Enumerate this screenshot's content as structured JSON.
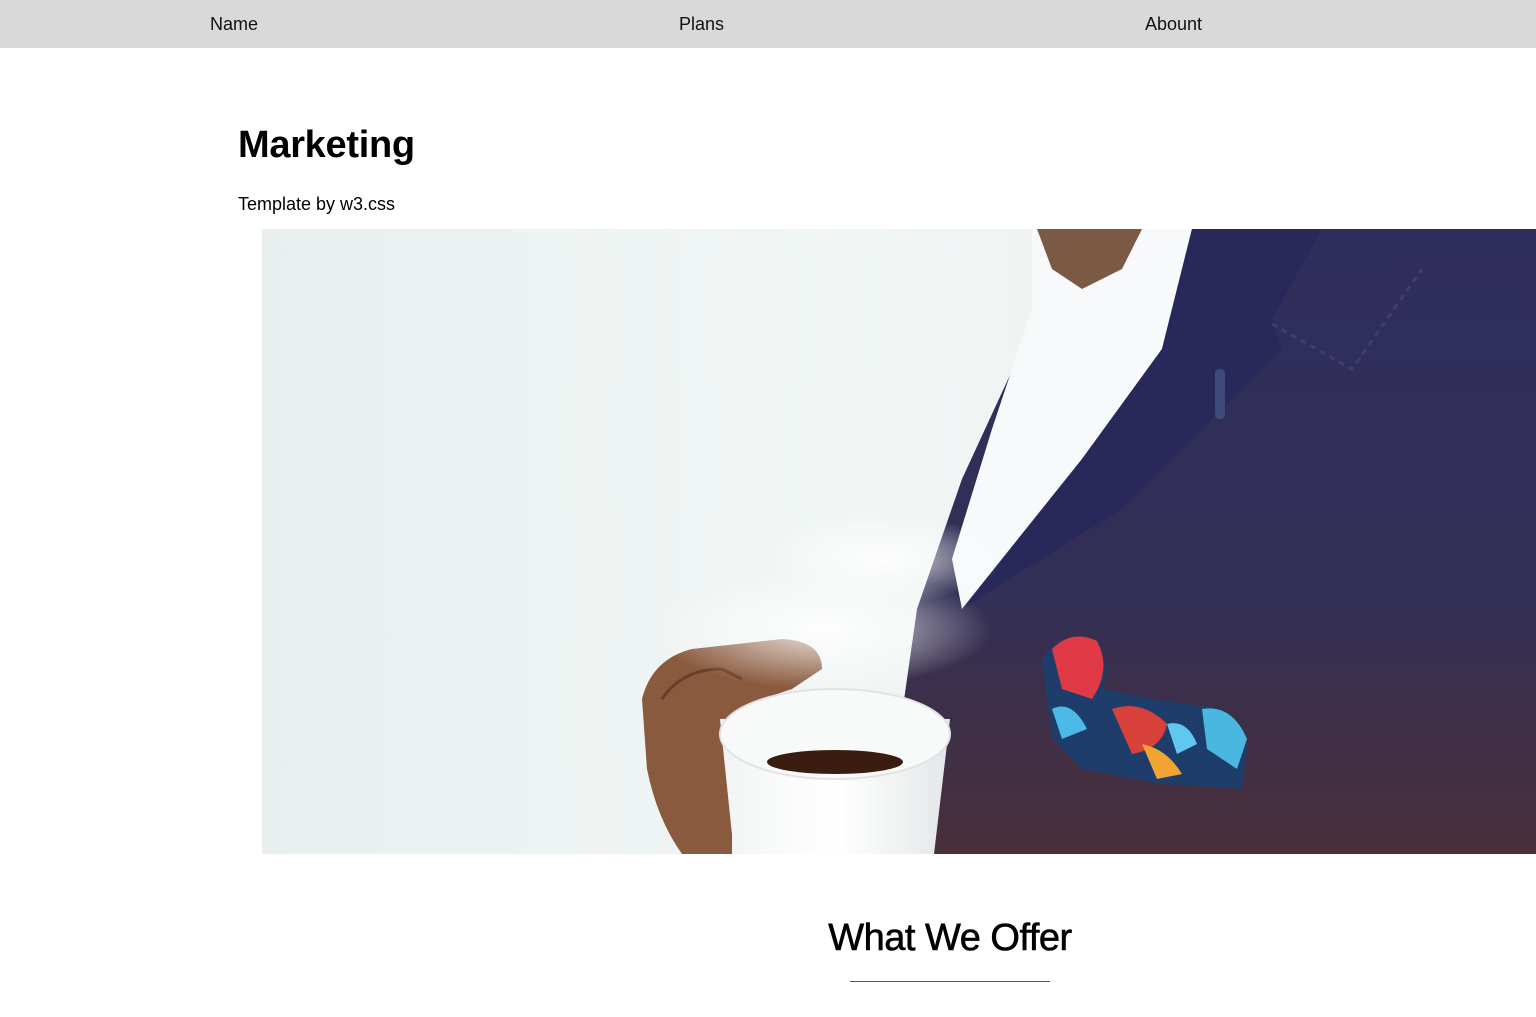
{
  "nav": {
    "items": [
      {
        "label": "Name"
      },
      {
        "label": "Plans"
      },
      {
        "label": "Abount"
      }
    ]
  },
  "header": {
    "title": "Marketing",
    "subtitle": "Template by w3.css"
  },
  "hero": {
    "image_subject": "man in navy suit holding white coffee cup",
    "colors": {
      "background": "#eef3f3",
      "suit": "#2e2c55",
      "shirt": "#f7f9fb",
      "skin": "#8a5a3e",
      "coffee": "#3a1c10"
    }
  },
  "section": {
    "title": "What We Offer"
  },
  "colors": {
    "nav_background": "#d9d9d9",
    "page_background": "#ffffff",
    "text": "#000000"
  }
}
